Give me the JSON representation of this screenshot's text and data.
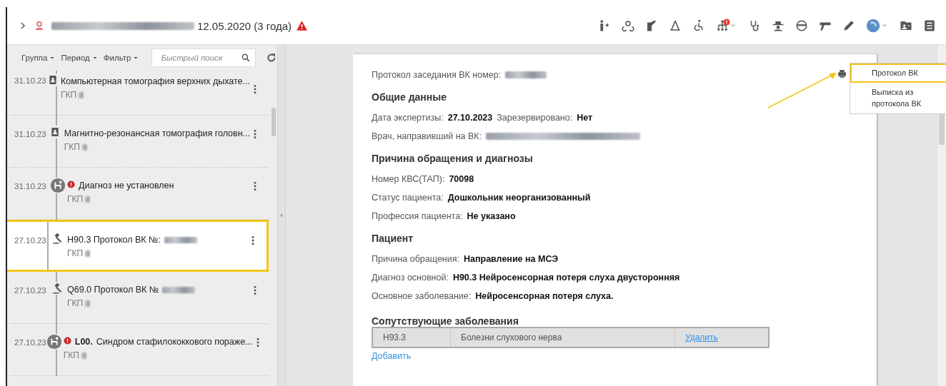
{
  "header": {
    "birth_info": "12.05.2020 (3 года)"
  },
  "filters": [
    {
      "label": "Группа"
    },
    {
      "label": "Период"
    },
    {
      "label": "Фильтр"
    }
  ],
  "search": {
    "placeholder": "Быстрый поиск"
  },
  "timeline": [
    {
      "date": "31.10.23",
      "kind": "lab",
      "alert": false,
      "title": "Компьютерная томография верхних дыхате...",
      "org": "ГКП",
      "selected": false
    },
    {
      "date": "31.10.23",
      "kind": "lab",
      "alert": false,
      "title": "Магнитно-резонансная томография головн...",
      "org": "ГКП",
      "selected": false
    },
    {
      "date": "31.10.23",
      "kind": "diagnosis",
      "alert": true,
      "title": "Диагноз не установлен",
      "org": "ГКП",
      "selected": false
    },
    {
      "date": "27.10.23",
      "kind": "protocol",
      "alert": false,
      "title": "H90.3 Протокол ВК №:",
      "org": "ГКП",
      "selected": true
    },
    {
      "date": "27.10.23",
      "kind": "protocol",
      "alert": false,
      "title": "Q69.0 Протокол ВК №",
      "org": "ГКП",
      "selected": false
    },
    {
      "date": "27.10.23",
      "kind": "diagnosis",
      "alert": true,
      "code": "L00.",
      "title": "Синдром стафилококкового пораже...",
      "org": "ГКП",
      "selected": false
    }
  ],
  "document": {
    "protocol_label": "Протокол заседания ВК номер:",
    "sections": [
      {
        "heading": "Общие данные",
        "rows": [
          [
            {
              "label": "Дата экспертизы:",
              "value": "27.10.2023"
            },
            {
              "label": "Зарезервировано:",
              "value": "Нет"
            }
          ],
          [
            {
              "label": "Врач, направивший на ВК:",
              "redacted": true
            }
          ]
        ]
      },
      {
        "heading": "Причина обращения и диагнозы",
        "rows": [
          [
            {
              "label": "Номер КВС(ТАП):",
              "value": "70098"
            }
          ],
          [
            {
              "label": "Статус пациента:",
              "value": "Дошкольник неорганизованный"
            }
          ],
          [
            {
              "label": "Профессия пациента:",
              "value": "Не указано"
            }
          ]
        ]
      },
      {
        "heading": "Пациент",
        "rows": [
          [
            {
              "label": "Причина обращения:",
              "value": "Направление на МСЭ"
            }
          ],
          [
            {
              "label": "Диагноз основной:",
              "value": "H90.3 Нейросенсорная потеря слуха двусторонняя"
            }
          ],
          [
            {
              "label": "Основное заболевание:",
              "value": "Нейросенсорная потеря слуха."
            }
          ]
        ]
      }
    ],
    "comorbidities": {
      "heading": "Сопутствующие заболевания",
      "rows": [
        {
          "code": "H93.3",
          "name": "Болезни слухового нерва",
          "action": "Удалить"
        }
      ],
      "add_link": "Добавить"
    }
  },
  "print_menu": {
    "items": [
      {
        "label": "Протокол ВК",
        "selected": true
      },
      {
        "label": "Выписка из протокола ВК",
        "selected": false
      }
    ]
  }
}
